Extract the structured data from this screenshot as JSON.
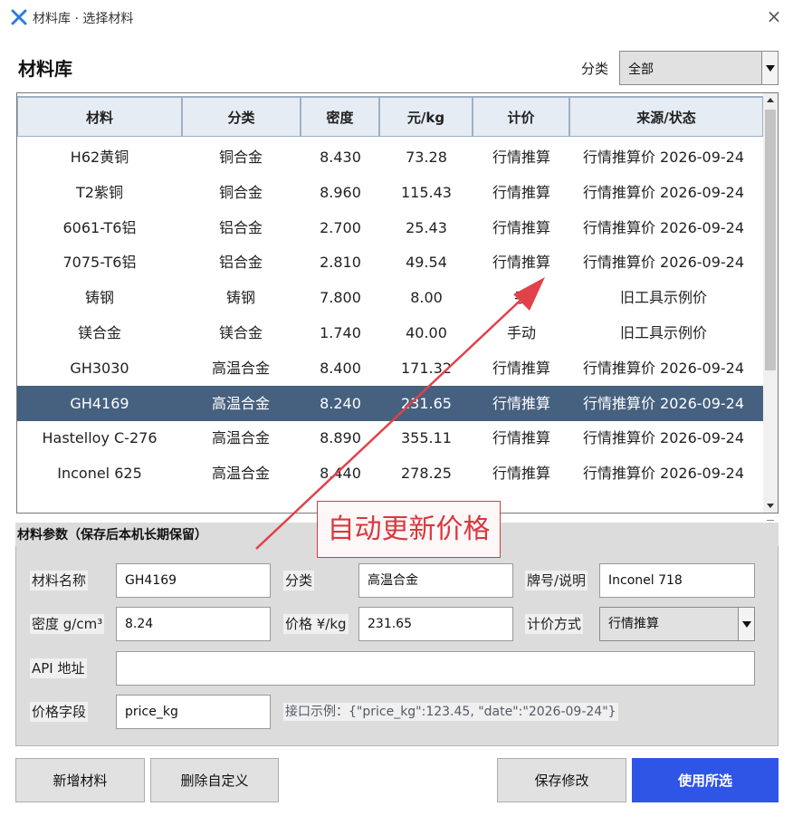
{
  "window": {
    "title": "材料库 · 选择材料",
    "close": "×"
  },
  "header": {
    "title": "材料库",
    "category_label": "分类",
    "category_value": "全部"
  },
  "table": {
    "columns": [
      "材料",
      "分类",
      "密度",
      "元/kg",
      "计价",
      "来源/状态"
    ],
    "rows": [
      [
        "H62黄铜",
        "铜合金",
        "8.430",
        "73.28",
        "行情推算",
        "行情推算价 2026-09-24"
      ],
      [
        "T2紫铜",
        "铜合金",
        "8.960",
        "115.43",
        "行情推算",
        "行情推算价 2026-09-24"
      ],
      [
        "6061-T6铝",
        "铝合金",
        "2.700",
        "25.43",
        "行情推算",
        "行情推算价 2026-09-24"
      ],
      [
        "7075-T6铝",
        "铝合金",
        "2.810",
        "49.54",
        "行情推算",
        "行情推算价 2026-09-24"
      ],
      [
        "铸钢",
        "铸钢",
        "7.800",
        "8.00",
        "手",
        "旧工具示例价"
      ],
      [
        "镁合金",
        "镁合金",
        "1.740",
        "40.00",
        "手动",
        "旧工具示例价"
      ],
      [
        "GH3030",
        "高温合金",
        "8.400",
        "171.32",
        "行情推算",
        "行情推算价 2026-09-24"
      ],
      [
        "GH4169",
        "高温合金",
        "8.240",
        "231.65",
        "行情推算",
        "行情推算价 2026-09-24"
      ],
      [
        "Hastelloy C-276",
        "高温合金",
        "8.890",
        "355.11",
        "行情推算",
        "行情推算价 2026-09-24"
      ],
      [
        "Inconel 625",
        "高温合金",
        "8.440",
        "278.25",
        "行情推算",
        "行情推算价 2026-09-24"
      ]
    ],
    "selected_row": "GH4169"
  },
  "params": {
    "group_title": "材料参数（保存后本机长期保留）",
    "name_label": "材料名称",
    "name_value": "GH4169",
    "category_label": "分类",
    "category_value": "高温合金",
    "grade_label": "牌号/说明",
    "grade_value": "Inconel 718",
    "density_label": "密度 g/cm³",
    "density_value": "8.24",
    "price_label": "价格 ¥/kg",
    "price_value": "231.65",
    "pricing_label": "计价方式",
    "pricing_value": "行情推算",
    "api_label": "API 地址",
    "api_value": "",
    "field_label": "价格字段",
    "field_value": "price_kg",
    "hint": "接口示例：{\"price_kg\":123.45, \"date\":\"2026-09-24\"}"
  },
  "buttons": {
    "add": "新增材料",
    "delete": "删除自定义",
    "save": "保存修改",
    "use": "使用所选"
  },
  "annotation": {
    "text": "自动更新价格",
    "color": "#d9383f"
  },
  "colors": {
    "selected_row": "#46607f",
    "primary": "#2f55e6",
    "header_bg": "#e6ecf3"
  }
}
